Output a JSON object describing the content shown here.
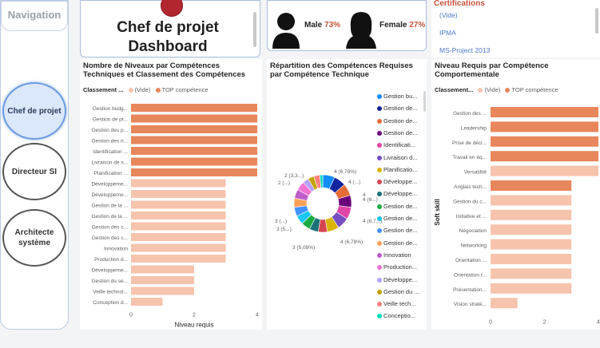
{
  "navigation": {
    "title": "Navigation",
    "items": [
      {
        "label": "Chef de projet",
        "active": true
      },
      {
        "label": "Directeur SI",
        "active": false
      },
      {
        "label": "Architecte système",
        "active": false
      }
    ]
  },
  "header": {
    "title": "Chef de projet Dashboard"
  },
  "gender": {
    "male_label": "Male",
    "male_pct": "73%",
    "female_label": "Female",
    "female_pct": "27%"
  },
  "certifications": {
    "title": "Certifications",
    "items": [
      "(Vide)",
      "IPMA",
      "MS-Project 2013"
    ]
  },
  "colors": {
    "top": "#e8865c",
    "vide": "#f6c3ad",
    "accent": "#c8553d"
  },
  "panel_technical": {
    "title": "Nombre de Niveaux par Compétences Techniques et Classement des Compétences",
    "legend_title": "Classement ...",
    "legend_vide": "(Vide)",
    "legend_top": "TOP compétence"
  },
  "panel_donut": {
    "title": "Répartition des Compétences Requises par Compétence Technique"
  },
  "panel_behavioral": {
    "title": "Niveau Requis par Compétence Comportementale",
    "legend_title": "Classement...",
    "legend_vide": "(Vide)",
    "legend_top": "TOP compétence"
  },
  "chart_data": [
    {
      "type": "bar",
      "orientation": "horizontal",
      "categories": [
        "Gestion budg...",
        "Gestion de pr...",
        "Gestion des p...",
        "Gestion des ri...",
        "Identification ...",
        "Livraison de s...",
        "Planification ...",
        "Développeme...",
        "Développeme...",
        "Gestion de la ...",
        "Gestion de la ...",
        "Gestion des c...",
        "Gestion des c...",
        "Innovation",
        "Production d...",
        "Développeme...",
        "Gestion du se...",
        "Veille technol...",
        "Conception d..."
      ],
      "values": [
        4,
        4,
        4,
        4,
        4,
        4,
        4,
        3,
        3,
        3,
        3,
        3,
        3,
        3,
        3,
        2,
        2,
        2,
        1
      ],
      "classes": [
        "TOP compétence",
        "TOP compétence",
        "TOP compétence",
        "TOP compétence",
        "TOP compétence",
        "TOP compétence",
        "TOP compétence",
        "(Vide)",
        "(Vide)",
        "(Vide)",
        "(Vide)",
        "(Vide)",
        "(Vide)",
        "(Vide)",
        "(Vide)",
        "(Vide)",
        "(Vide)",
        "(Vide)",
        "(Vide)"
      ],
      "xlabel": "Niveau requis",
      "xticks": [
        "0",
        "2",
        "4"
      ],
      "xlim": [
        0,
        4
      ]
    },
    {
      "type": "pie",
      "donut": true,
      "labels": [
        "Gestion bu...",
        "Gestion de...",
        "Gestion de...",
        "Gestion de...",
        "Identificati...",
        "Livraison d...",
        "Planificatio...",
        "Développe...",
        "Développe...",
        "Gestion de...",
        "Gestion de...",
        "Gestion de...",
        "Gestion de...",
        "Innovation",
        "Production...",
        "Développe...",
        "Gestion du ...",
        "Veille tech...",
        "Conceptio..."
      ],
      "values": [
        4,
        4,
        4,
        4,
        4,
        4,
        4,
        3,
        3,
        3,
        3,
        3,
        3,
        3,
        3,
        2,
        2,
        2,
        1
      ],
      "colors": [
        "#118dff",
        "#12239e",
        "#e66c37",
        "#6b007b",
        "#e044a7",
        "#744ec2",
        "#d9b300",
        "#d64550",
        "#197278",
        "#1aab40",
        "#15c6f4",
        "#4092ff",
        "#ffa058",
        "#be5dc9",
        "#f472d0",
        "#b5a1ff",
        "#c4a200",
        "#ff8080",
        "#00dbbc"
      ],
      "data_labels": [
        "4 (6.78%)",
        "4 (...)",
        "4 (6...)",
        "4",
        "4 (6,7...)",
        "4 (6.78%)",
        "3 (5,08%)",
        "3 (5...)",
        "3 (...)",
        "2 (...)",
        "2 (3,3...)"
      ]
    },
    {
      "type": "bar",
      "orientation": "horizontal",
      "categories": [
        "Gestion des ...",
        "Leadership",
        "Prise de déci...",
        "Travail en éq...",
        "Versatilité",
        "Anglais tech...",
        "Gestion du c...",
        "Initiative et ...",
        "Négociation",
        "Networking",
        "Orientation ...",
        "Orientation r...",
        "Présentation...",
        "Vision straté..."
      ],
      "values": [
        4,
        4,
        4,
        4,
        4,
        3,
        3,
        3,
        3,
        3,
        3,
        3,
        3,
        1
      ],
      "classes": [
        "TOP compétence",
        "TOP compétence",
        "TOP compétence",
        "TOP compétence",
        "(Vide)",
        "TOP compétence",
        "(Vide)",
        "(Vide)",
        "(Vide)",
        "(Vide)",
        "(Vide)",
        "(Vide)",
        "(Vide)",
        "(Vide)"
      ],
      "ylabel": "Soft skill",
      "xticks": [
        "0",
        "2",
        "4"
      ],
      "xlim": [
        0,
        4
      ]
    }
  ]
}
